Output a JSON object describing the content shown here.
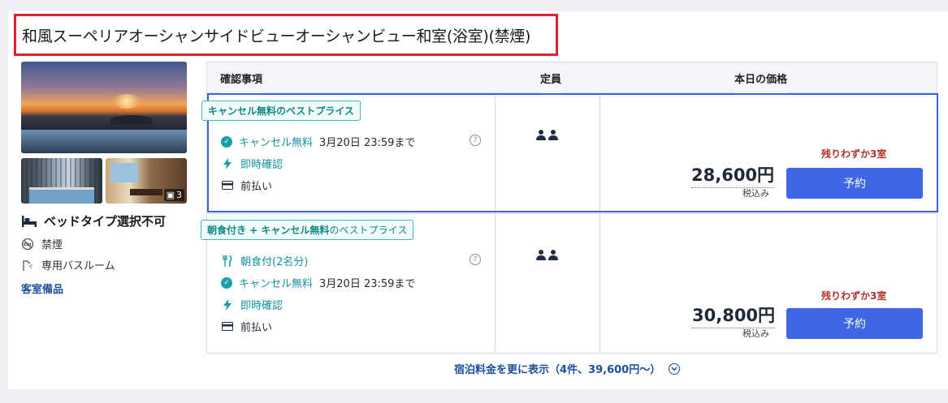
{
  "room": {
    "title": "和風スーペリアオーシャンサイドビューオーシャンビュー和室(浴室)(禁煙)",
    "photo_count": "3",
    "bed_type": "ベッドタイプ選択不可",
    "smoking": "禁煙",
    "bath": "専用バスルーム",
    "amenities_link": "客室備品"
  },
  "table": {
    "headers": {
      "details": "確認事項",
      "capacity": "定員",
      "price": "本日の価格"
    }
  },
  "plans": [
    {
      "badge": "キャンセル無料のベストプライス",
      "features": [
        {
          "icon": "check-circle-icon",
          "label": "キャンセル無料",
          "note": "3月20日 23:59まで"
        },
        {
          "icon": "lightning-icon",
          "label": "即時確認"
        },
        {
          "icon": "card-icon",
          "label": "前払い"
        }
      ],
      "remaining": "残りわずか3室",
      "price": "28,600円",
      "tax": "税込み",
      "book": "予約"
    },
    {
      "badge_bold": "朝食付き + キャンセル無料",
      "badge_light": "のベストプライス",
      "features": [
        {
          "icon": "fork-knife-icon",
          "label": "朝食付(2名分)"
        },
        {
          "icon": "check-circle-icon",
          "label": "キャンセル無料",
          "note": "3月20日 23:59まで"
        },
        {
          "icon": "lightning-icon",
          "label": "即時確認"
        },
        {
          "icon": "card-icon",
          "label": "前払い"
        }
      ],
      "remaining": "残りわずか3室",
      "price": "30,800円",
      "tax": "税込み",
      "book": "予約"
    }
  ],
  "more_link": "宿泊料金を更に表示（4件、39,600円〜）",
  "colors": {
    "accent": "#3e66e6",
    "teal": "#1493a0",
    "warning": "#b0332b",
    "highlight": "#e0202a"
  }
}
